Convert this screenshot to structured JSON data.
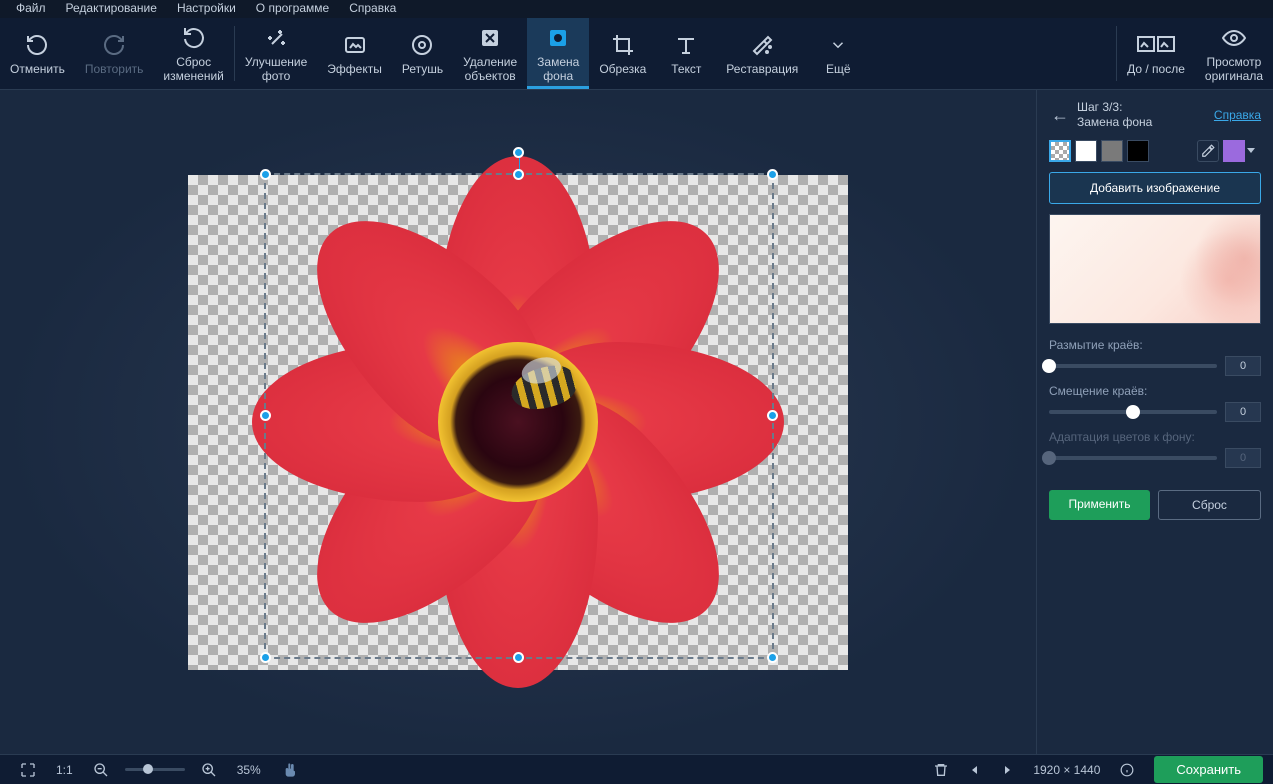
{
  "menubar": [
    "Файл",
    "Редактирование",
    "Настройки",
    "О программе",
    "Справка"
  ],
  "toolbar": {
    "undo": "Отменить",
    "redo": "Повторить",
    "reset": "Сброс\nизменений",
    "enhance": "Улучшение\nфото",
    "effects": "Эффекты",
    "retouch": "Ретушь",
    "remove_obj": "Удаление\nобъектов",
    "replace_bg": "Замена\nфона",
    "crop": "Обрезка",
    "text": "Текст",
    "restoration": "Реставрация",
    "more": "Ещё",
    "before_after": "До / после",
    "view_original": "Просмотр\nоригинала"
  },
  "panel": {
    "step": "Шаг 3/3:",
    "title": "Замена фона",
    "help": "Справка",
    "add_image": "Добавить изображение",
    "sliders": {
      "blur": {
        "label": "Размытие краёв:",
        "value": "0",
        "pos": 0
      },
      "shift": {
        "label": "Смещение краёв:",
        "value": "0",
        "pos": 50
      },
      "adapt": {
        "label": "Адаптация цветов к фону:",
        "value": "0",
        "pos": 0
      }
    },
    "apply": "Применить",
    "reset": "Сброс"
  },
  "bottombar": {
    "fit": "1:1",
    "zoom": "35%",
    "dimensions": "1920 × 1440",
    "save": "Сохранить"
  }
}
